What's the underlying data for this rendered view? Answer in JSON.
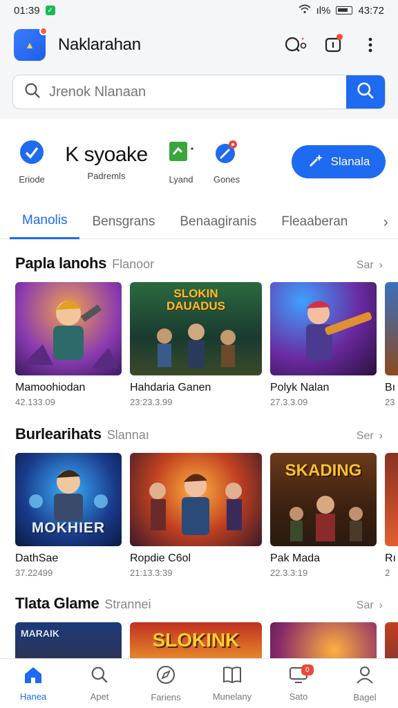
{
  "status_bar": {
    "time": "01:39",
    "battery_pct": "ıl%",
    "clock_right": "43:72"
  },
  "header": {
    "app_title": "Naklarahan"
  },
  "search": {
    "placeholder": "Jrenok Nlanaan"
  },
  "quick_actions": {
    "items": [
      {
        "label": "Eriode",
        "icon": "check-circle-icon",
        "color": "#1e6af0"
      },
      {
        "big_text": "K syoake",
        "label": "Padremls"
      },
      {
        "label": "Lyand",
        "icon": "green-flag-icon",
        "color": "#3aa63a"
      },
      {
        "label": "Gones",
        "icon": "rocket-badge-icon",
        "color": "#1e6af0"
      }
    ],
    "primary_button": "Slanala"
  },
  "tabs": [
    "Manolis",
    "Bensgrans",
    "Benaagiranis",
    "Fleaaberan"
  ],
  "sections": [
    {
      "title": "Papla lanohs",
      "subtitle": "Flanoor",
      "more": "Sar",
      "cards": [
        {
          "name": "Mamoohiodan",
          "meta": "42.133.09"
        },
        {
          "name": "Hahdaria Ganen",
          "meta": "23:23.3.99",
          "thumb_text": "SLOKIN DAUADUS"
        },
        {
          "name": "Polyk Nalan",
          "meta": "27.3.3.09"
        },
        {
          "name": "Bı",
          "meta": "23"
        }
      ]
    },
    {
      "title": "Burlearihats",
      "subtitle": "Slannaı",
      "more": "Ser",
      "cards": [
        {
          "name": "DathSae",
          "meta": "37.22499",
          "thumb_text": "MOKHIER"
        },
        {
          "name": "Ropdie C6ol",
          "meta": "21:13.3:39"
        },
        {
          "name": "Pak Mada",
          "meta": "22.3.3:19",
          "thumb_text": "SKADING"
        },
        {
          "name": "Rı",
          "meta": "2"
        }
      ]
    },
    {
      "title": "Tlata Glame",
      "subtitle": "Strannei",
      "more": "Sar",
      "cards": [
        {
          "name": "",
          "meta": "",
          "thumb_text": "MARAIK"
        },
        {
          "name": "",
          "meta": "",
          "thumb_text": "SLOKINK"
        },
        {
          "name": "",
          "meta": ""
        },
        {
          "name": "",
          "meta": ""
        }
      ]
    }
  ],
  "bottom_nav": [
    {
      "label": "Hanea",
      "icon": "home-icon",
      "active": true
    },
    {
      "label": "Apet",
      "icon": "search-icon"
    },
    {
      "label": "Fariens",
      "icon": "compass-icon"
    },
    {
      "label": "Munelany",
      "icon": "book-icon"
    },
    {
      "label": "Sato",
      "icon": "tv-icon",
      "badge": "0"
    },
    {
      "label": "Bagel",
      "icon": "profile-icon"
    }
  ]
}
